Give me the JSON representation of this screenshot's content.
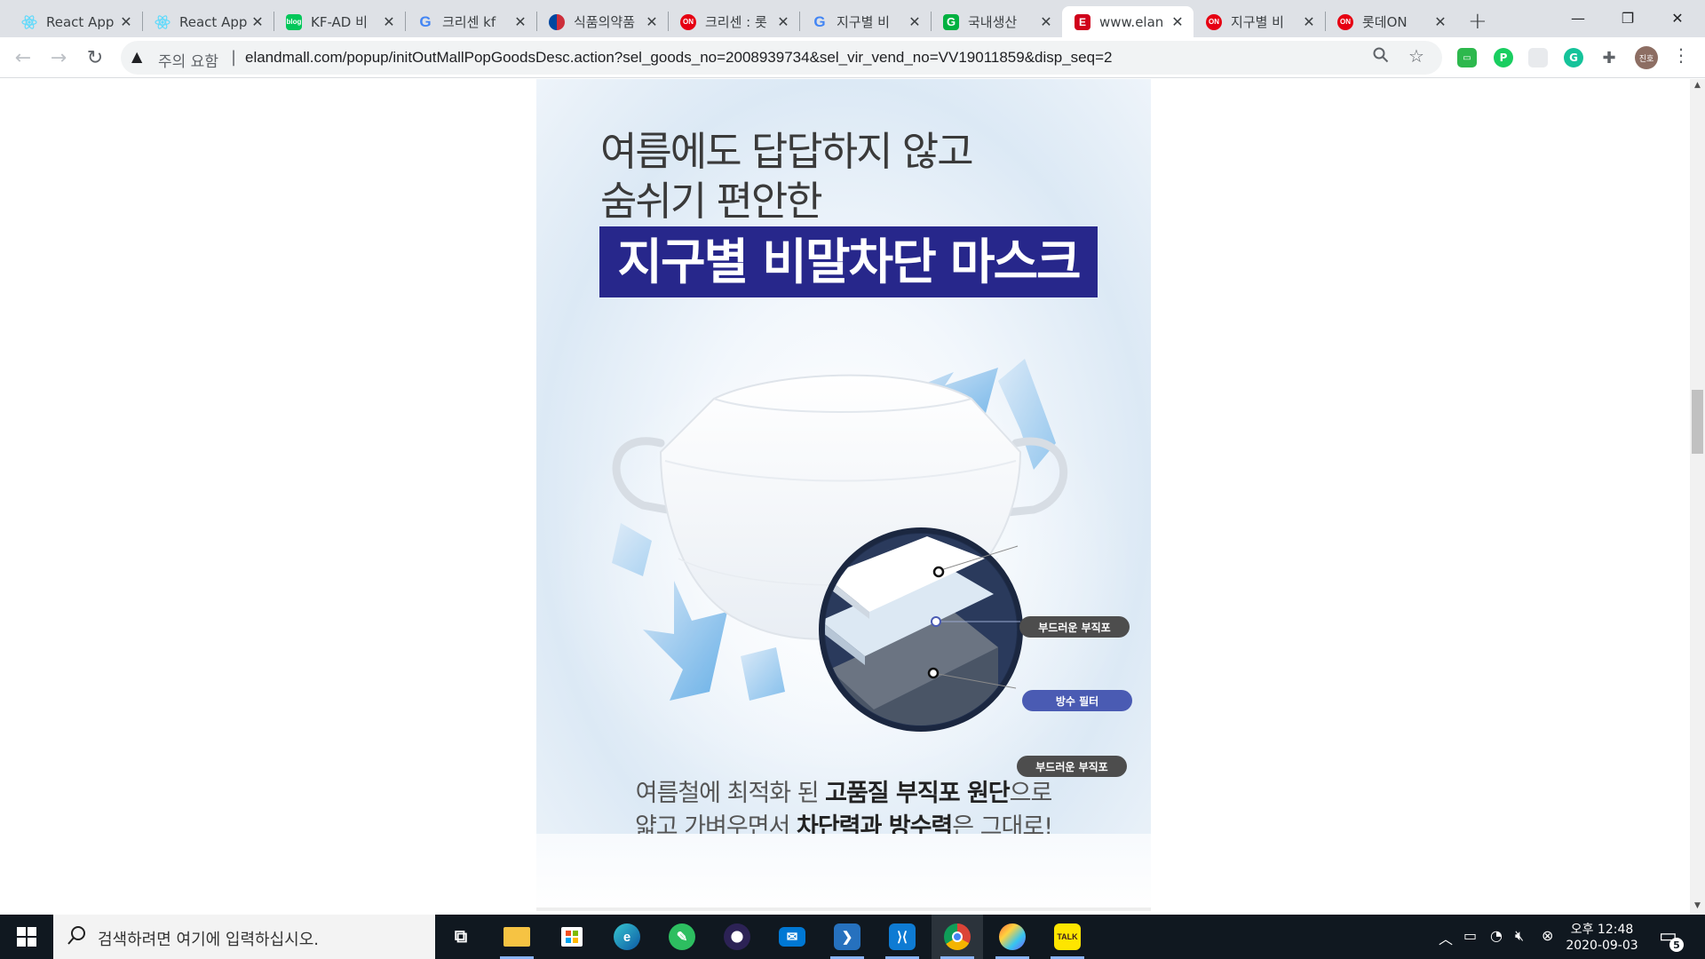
{
  "browser": {
    "tabs": [
      {
        "title": "React App",
        "favicon": "react-icon",
        "favicon_color": "#61dafb"
      },
      {
        "title": "React App",
        "favicon": "react-icon",
        "favicon_color": "#61dafb"
      },
      {
        "title": "KF-AD 비",
        "favicon": "blog-icon",
        "favicon_color": "#03c75a"
      },
      {
        "title": "크리센 kf",
        "favicon": "google-icon",
        "favicon_color": "#4285f4"
      },
      {
        "title": "식품의약품",
        "favicon": "gov-icon",
        "favicon_color": "#003478"
      },
      {
        "title": "크리센 : 롯",
        "favicon": "lotteon-icon",
        "favicon_color": "#e60012"
      },
      {
        "title": "지구별 비",
        "favicon": "google-icon",
        "favicon_color": "#4285f4"
      },
      {
        "title": "국내생산",
        "favicon": "g-icon",
        "favicon_color": "#00b140"
      },
      {
        "title": "www.elan",
        "favicon": "eland-icon",
        "favicon_color": "#d0021b",
        "active": true
      },
      {
        "title": "지구별 비",
        "favicon": "lotteon-icon",
        "favicon_color": "#e60012"
      },
      {
        "title": "롯데ON",
        "favicon": "lotteon-icon",
        "favicon_color": "#e60012"
      }
    ],
    "security_label": "주의 요함",
    "url": "elandmall.com/popup/initOutMallPopGoodsDesc.action?sel_goods_no=2008939734&sel_vir_vend_no=VV19011859&disp_seq=2",
    "profile_label": "진호"
  },
  "product": {
    "headline_1": "여름에도 답답하지 않고",
    "headline_2": "숨쉬기 편안한",
    "title": "지구별 비말차단 마스크",
    "title_bg": "#27278b",
    "layers": [
      "부드러운 부직포",
      "방수 필터",
      "부드러운 부직포"
    ],
    "desc_1_pre": "여름철에 최적화 된 ",
    "desc_1_bold": "고품질 부직포 원단",
    "desc_1_post": "으로",
    "desc_2_pre": "얇고 가벼우면서 ",
    "desc_2_bold": "차단력과 방수력",
    "desc_2_post": "은 그대로!"
  },
  "taskbar": {
    "search_placeholder": "검색하려면 여기에 입력하십시오.",
    "clock_time": "오후 12:48",
    "clock_date": "2020-09-03",
    "notification_count": "5",
    "apps": [
      "task-view",
      "file-explorer",
      "microsoft-store",
      "edge",
      "evernote",
      "eclipse",
      "mail",
      "powershell",
      "vscode",
      "chrome",
      "paint",
      "kakaotalk"
    ],
    "kakaotalk_label": "TALK"
  }
}
